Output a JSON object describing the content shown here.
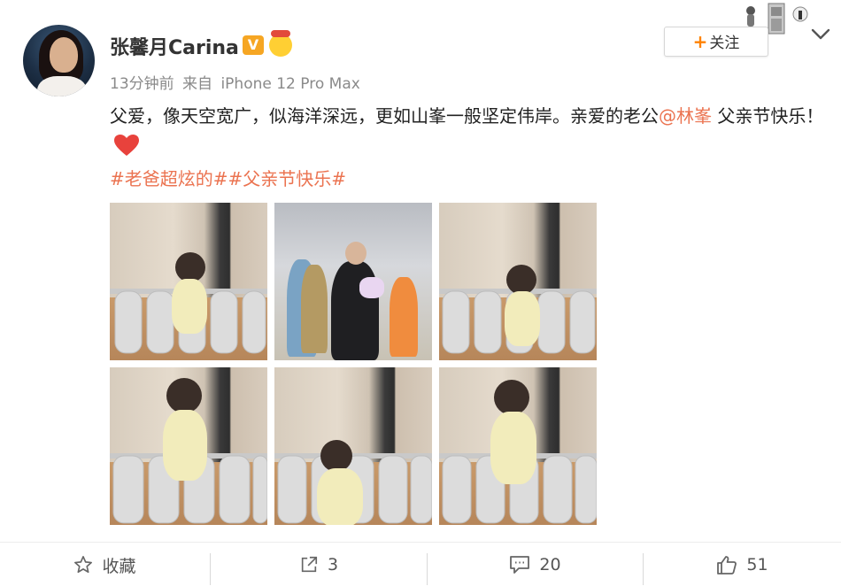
{
  "user": {
    "name": "张馨月Carina",
    "vip_letter": "V",
    "time": "13分钟前",
    "source_prefix": "来自",
    "device": "iPhone 12 Pro Max"
  },
  "follow_button": {
    "plus": "+",
    "label": "关注"
  },
  "post": {
    "text_before_mention": "父爱，像天空宽广，似海洋深远，更如山峯一般坚定伟岸。亲爱的老公",
    "mention": "@林峯",
    "text_after_mention": " 父亲节快乐！",
    "hashtags": [
      "#老爸超炫的#",
      "#父亲节快乐#"
    ]
  },
  "photos": [
    "photo-1",
    "photo-2",
    "photo-3",
    "photo-4",
    "photo-5",
    "photo-6"
  ],
  "actions": {
    "favorite": "收藏",
    "repost": "3",
    "comment": "20",
    "like": "51"
  },
  "colors": {
    "accent": "#eb7350",
    "follow_plus": "#ff8200",
    "vip": "#f6a623",
    "heart": "#e8423c"
  }
}
